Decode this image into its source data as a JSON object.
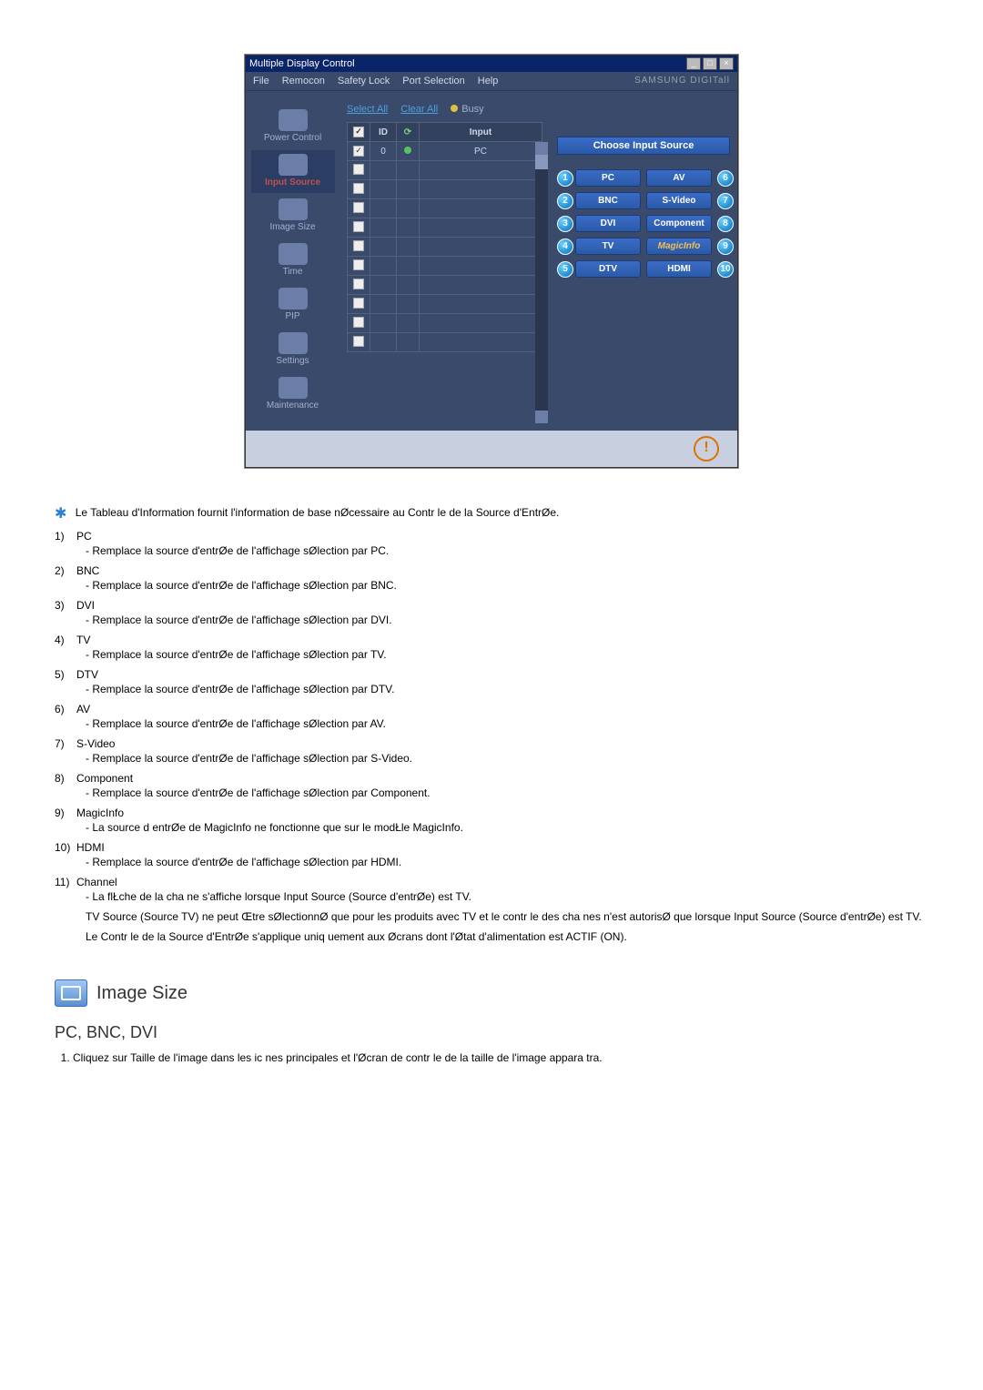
{
  "window": {
    "title": "Multiple Display Control",
    "menu": [
      "File",
      "Remocon",
      "Safety Lock",
      "Port Selection",
      "Help"
    ],
    "brand": "SAMSUNG DIGITall"
  },
  "sidebar": {
    "items": [
      {
        "label": "Power Control"
      },
      {
        "label": "Input Source"
      },
      {
        "label": "Image Size"
      },
      {
        "label": "Time"
      },
      {
        "label": "PIP"
      },
      {
        "label": "Settings"
      },
      {
        "label": "Maintenance"
      }
    ]
  },
  "toolbar": {
    "select_all": "Select All",
    "clear_all": "Clear All",
    "busy": "Busy"
  },
  "grid": {
    "headers": {
      "chk": "",
      "id": "ID",
      "status": "",
      "input": "Input"
    },
    "rows": [
      {
        "checked": true,
        "id": "0",
        "status": "on",
        "input": "PC"
      },
      {
        "checked": false,
        "id": "",
        "status": "",
        "input": ""
      },
      {
        "checked": false,
        "id": "",
        "status": "",
        "input": ""
      },
      {
        "checked": false,
        "id": "",
        "status": "",
        "input": ""
      },
      {
        "checked": false,
        "id": "",
        "status": "",
        "input": ""
      },
      {
        "checked": false,
        "id": "",
        "status": "",
        "input": ""
      },
      {
        "checked": false,
        "id": "",
        "status": "",
        "input": ""
      },
      {
        "checked": false,
        "id": "",
        "status": "",
        "input": ""
      },
      {
        "checked": false,
        "id": "",
        "status": "",
        "input": ""
      },
      {
        "checked": false,
        "id": "",
        "status": "",
        "input": ""
      },
      {
        "checked": false,
        "id": "",
        "status": "",
        "input": ""
      }
    ]
  },
  "right": {
    "header": "Choose Input Source",
    "buttons": [
      {
        "n": "1",
        "label": "PC"
      },
      {
        "n": "6",
        "label": "AV"
      },
      {
        "n": "2",
        "label": "BNC"
      },
      {
        "n": "7",
        "label": "S-Video"
      },
      {
        "n": "3",
        "label": "DVI"
      },
      {
        "n": "8",
        "label": "Component"
      },
      {
        "n": "4",
        "label": "TV"
      },
      {
        "n": "9",
        "label": "MagicInfo",
        "alt": true
      },
      {
        "n": "5",
        "label": "DTV"
      },
      {
        "n": "10",
        "label": "HDMI"
      }
    ]
  },
  "intro": "Le Tableau d'Information fournit l'information de base nØcessaire au Contr le de la Source d'EntrØe.",
  "list": [
    {
      "n": "1)",
      "label": "PC",
      "desc": "- Remplace la source d'entrØe de l'affichage sØlection par PC."
    },
    {
      "n": "2)",
      "label": "BNC",
      "desc": "- Remplace la source d'entrØe de l'affichage sØlection par BNC."
    },
    {
      "n": "3)",
      "label": "DVI",
      "desc": "- Remplace la source d'entrØe de l'affichage sØlection par DVI."
    },
    {
      "n": "4)",
      "label": "TV",
      "desc": "- Remplace la source d'entrØe de l'affichage sØlection par TV."
    },
    {
      "n": "5)",
      "label": "DTV",
      "desc": "- Remplace la source d'entrØe de l'affichage sØlection par DTV."
    },
    {
      "n": "6)",
      "label": "AV",
      "desc": "- Remplace la source d'entrØe de l'affichage sØlection par AV."
    },
    {
      "n": "7)",
      "label": "S-Video",
      "desc": "- Remplace la source d'entrØe de l'affichage sØlection par S-Video."
    },
    {
      "n": "8)",
      "label": "Component",
      "desc": "- Remplace la source d'entrØe de l'affichage sØlection par Component."
    },
    {
      "n": "9)",
      "label": "MagicInfo",
      "desc": "- La source d entrØe de MagicInfo ne fonctionne que sur le modŁle MagicInfo."
    },
    {
      "n": "10)",
      "label": "HDMI",
      "desc": "- Remplace la source d'entrØe de l'affichage sØlection par HDMI."
    },
    {
      "n": "11)",
      "label": "Channel",
      "desc": "- La flŁche de la cha ne s'affiche lorsque Input Source (Source d'entrØe) est TV."
    }
  ],
  "notes": [
    "TV Source (Source TV) ne peut Œtre sØlectionnØ que pour les produits avec TV et le contr le des cha nes n'est autorisØ que lorsque Input Source (Source d'entrØe) est TV.",
    "Le Contr le de la Source d'EntrØe s'applique uniq        uement aux Øcrans dont l'Øtat d'alimentation est ACTIF (ON)."
  ],
  "section": {
    "title": "Image Size",
    "sub": "PC, BNC, DVI",
    "step1": "Cliquez sur Taille de l'image dans les ic nes principales et l'Øcran de contr le de la taille de l'image appara tra."
  }
}
